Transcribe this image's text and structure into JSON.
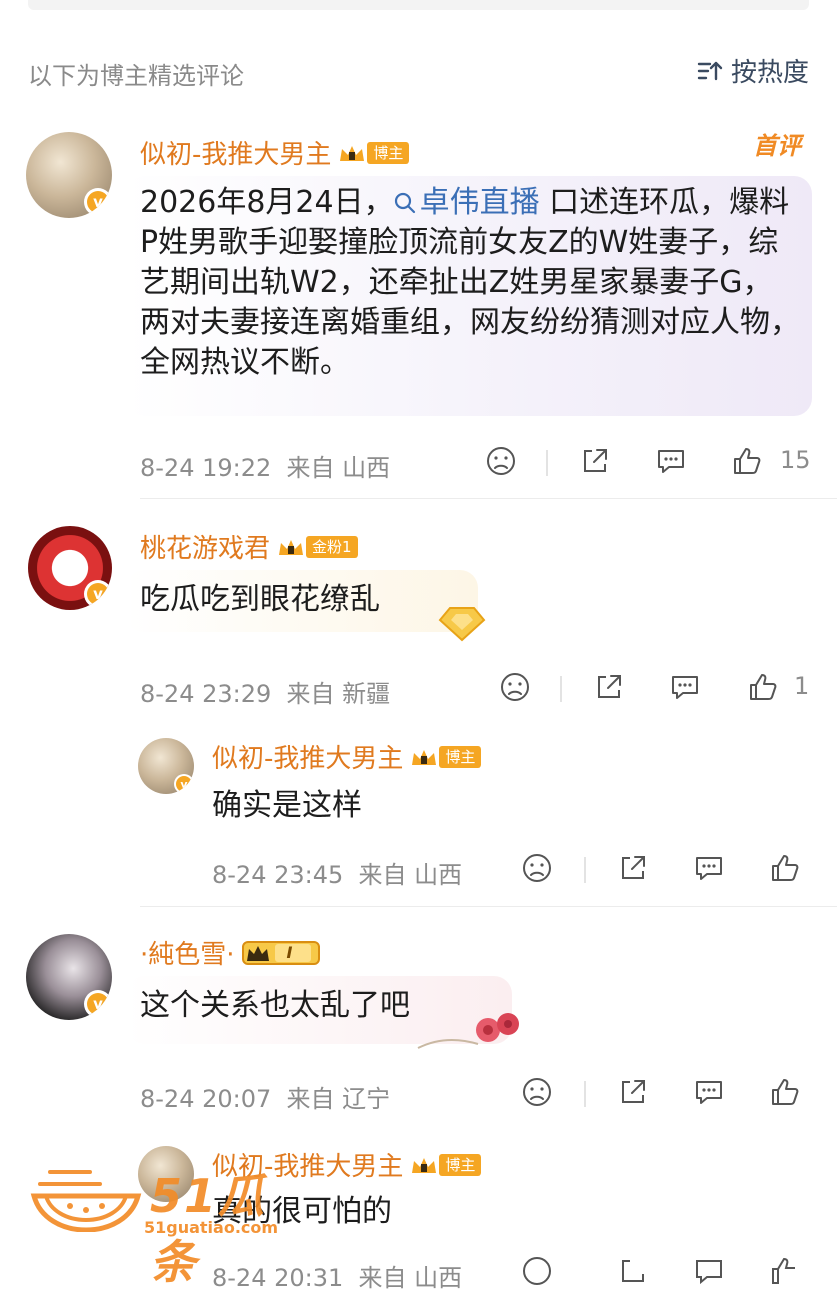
{
  "header": {
    "title": "以下为博主精选评论",
    "sort_label": "按热度"
  },
  "first_badge": "首评",
  "comments": [
    {
      "user": "似初-我推大男主",
      "badge": "博主",
      "text_before": "2026年8月24日，",
      "topic": "卓伟直播",
      "text_after": " 口述连环瓜，爆料P姓男歌手迎娶撞脸顶流前女友Z的W姓妻子，综艺期间出轨W2，还牵扯出Z姓男星家暴妻子G，两对夫妻接连离婚重组，网友纷纷猜测对应人物，全网热议不断。",
      "time": "8-24 19:22",
      "location": "来自 山西",
      "likes": "15"
    },
    {
      "user": "桃花游戏君",
      "badge": "金粉1",
      "text": "吃瓜吃到眼花缭乱",
      "time": "8-24 23:29",
      "location": "来自 新疆",
      "likes": "1"
    },
    {
      "user": "似初-我推大男主",
      "badge": "博主",
      "text": "确实是这样",
      "time": "8-24 23:45",
      "location": "来自 山西",
      "likes": ""
    },
    {
      "user": "·純色雪·",
      "badge": "I",
      "text": "这个关系也太乱了吧",
      "time": "8-24 20:07",
      "location": "来自 辽宁",
      "likes": ""
    },
    {
      "user": "似初-我推大男主",
      "badge": "博主",
      "text": "真的很可怕的",
      "time": "8-24 20:31",
      "location": "来自 山西",
      "likes": ""
    }
  ],
  "watermark": {
    "main": "51瓜条",
    "sub": "51guatiao.com"
  },
  "colors": {
    "username": "#e07a1f",
    "badge": "#f5a623",
    "topic": "#3b6fb6",
    "meta": "#8c8c8c"
  }
}
